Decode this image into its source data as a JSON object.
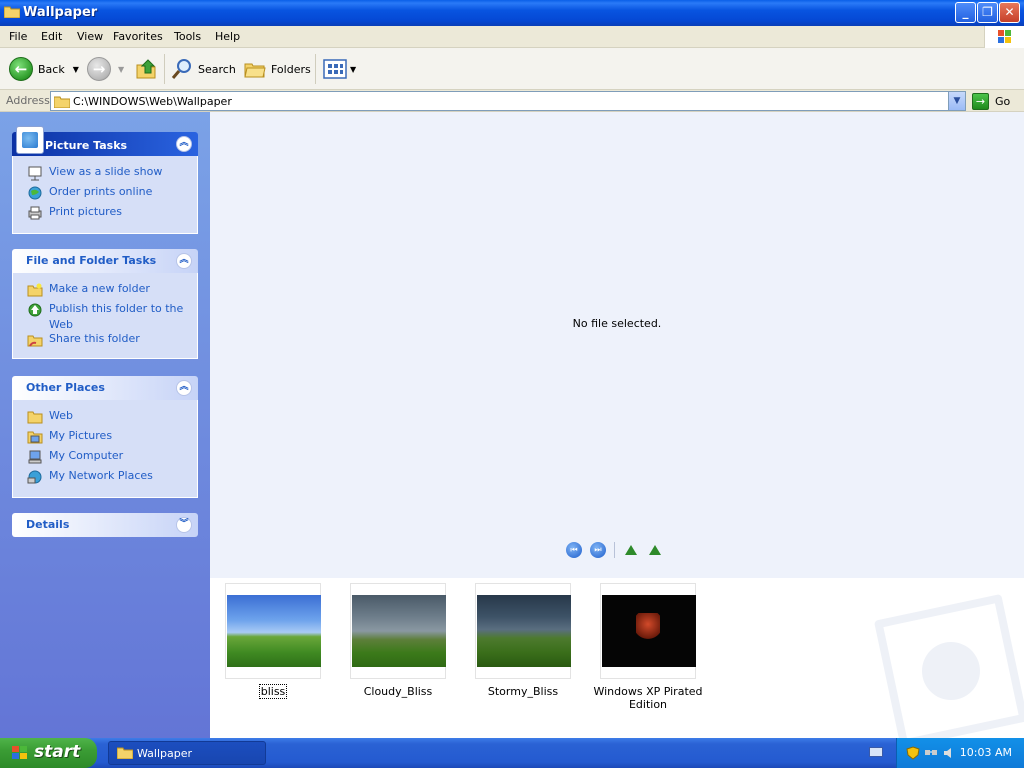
{
  "window": {
    "title": "Wallpaper"
  },
  "menu": [
    "File",
    "Edit",
    "View",
    "Favorites",
    "Tools",
    "Help"
  ],
  "toolbar": {
    "back": "Back",
    "search": "Search",
    "folders": "Folders"
  },
  "address": {
    "label": "Address",
    "value": "C:\\WINDOWS\\Web\\Wallpaper",
    "go": "Go"
  },
  "left_panel": {
    "picture_tasks": {
      "title": "Picture Tasks",
      "items": [
        "View as a slide show",
        "Order prints online",
        "Print pictures"
      ]
    },
    "file_folder_tasks": {
      "title": "File and Folder Tasks",
      "items": [
        "Make a new folder",
        "Publish this folder to the Web",
        "Share this folder"
      ]
    },
    "other_places": {
      "title": "Other Places",
      "items": [
        "Web",
        "My Pictures",
        "My Computer",
        "My Network Places"
      ]
    },
    "details": {
      "title": "Details"
    }
  },
  "preview": {
    "message": "No file selected."
  },
  "thumbnails": [
    {
      "name": "bliss"
    },
    {
      "name": "Cloudy_Bliss"
    },
    {
      "name": "Stormy_Bliss"
    },
    {
      "name": "Windows XP Pirated Edition"
    }
  ],
  "taskbar": {
    "start": "start",
    "tasks": [
      "Wallpaper"
    ],
    "clock": "10:03 AM"
  },
  "colors": {
    "titlebar": "#0548d4",
    "link": "#215dc6",
    "left_pane_top": "#7ba2e7",
    "left_pane_bottom": "#6375d6",
    "start_green": "#3b9d35",
    "taskbar_blue": "#245ad0"
  }
}
